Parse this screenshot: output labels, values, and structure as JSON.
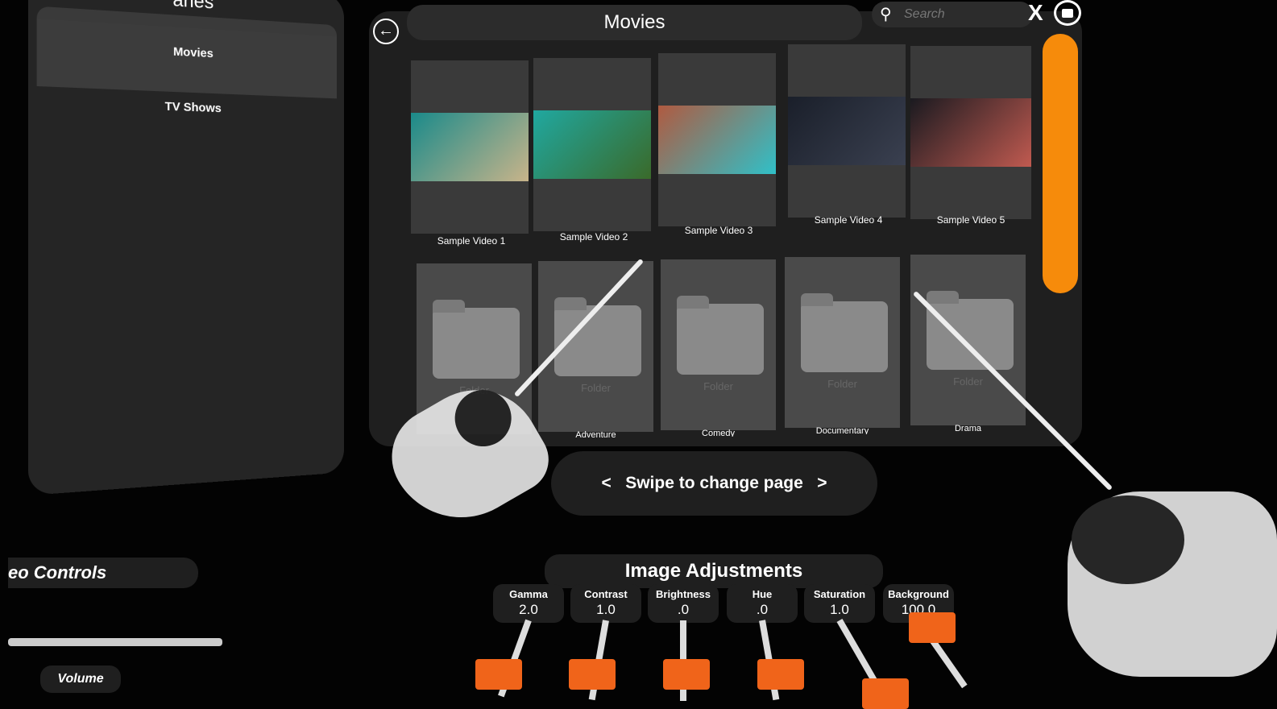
{
  "left_panel": {
    "title": "aries",
    "items": [
      {
        "label": "Movies",
        "selected": true
      },
      {
        "label": "TV Shows"
      }
    ]
  },
  "header": {
    "title": "Movies",
    "back_icon": "arrow-left-circle-icon",
    "search_placeholder": "Search",
    "close_label": "X",
    "folder_icon": "folder-icon"
  },
  "videos": [
    {
      "label": "Sample Video 1",
      "colors": [
        "#1a8a8a",
        "#c8b48a"
      ]
    },
    {
      "label": "Sample Video 2",
      "colors": [
        "#20a8a0",
        "#3a6a2a"
      ]
    },
    {
      "label": "Sample Video 3",
      "colors": [
        "#b05a40",
        "#30c0c8"
      ]
    },
    {
      "label": "Sample Video 4",
      "colors": [
        "#1a1f2a",
        "#3a4050"
      ]
    },
    {
      "label": "Sample Video 5",
      "colors": [
        "#1a1a20",
        "#c05a50"
      ]
    }
  ],
  "folders": [
    {
      "text": "Folder",
      "label": ""
    },
    {
      "text": "Folder",
      "label": "Adventure"
    },
    {
      "text": "Folder",
      "label": "Comedy"
    },
    {
      "text": "Folder",
      "label": "Documentary"
    },
    {
      "text": "Folder",
      "label": "Drama"
    }
  ],
  "scrollbar_color": "#f68b0b",
  "swipe": {
    "prev": "<",
    "label": "Swipe to change page",
    "next": ">"
  },
  "video_controls": {
    "title": "eo Controls",
    "volume_label": "Volume"
  },
  "image_adjustments": {
    "title": "Image Adjustments",
    "sliders": [
      {
        "name": "Gamma",
        "value": "2.0"
      },
      {
        "name": "Contrast",
        "value": "1.0"
      },
      {
        "name": "Brightness",
        "value": ".0"
      },
      {
        "name": "Hue",
        "value": ".0"
      },
      {
        "name": "Saturation",
        "value": "1.0"
      },
      {
        "name": "Background",
        "value": "100.0"
      }
    ],
    "knob_color": "#f0641a"
  }
}
